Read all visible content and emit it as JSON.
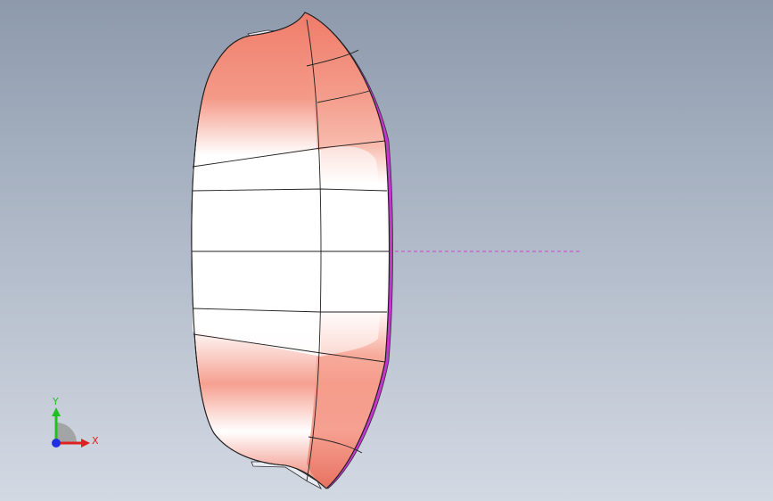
{
  "viewport": {
    "background_top": "#8d9aac",
    "background_bottom": "#d3d9e3"
  },
  "model": {
    "body_color": "#f08a78",
    "highlight_color": "#ffffff",
    "rim_color": "#d040d0",
    "centerline_color": "#d040d0",
    "edge_color": "#202020"
  },
  "triad": {
    "x_label": "X",
    "y_label": "Y",
    "x_color": "#e02020",
    "y_color": "#20c020",
    "z_color": "#2030e0"
  }
}
